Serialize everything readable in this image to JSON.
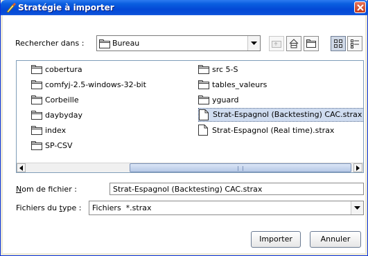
{
  "window": {
    "title": "Stratégie à importer"
  },
  "look_in": {
    "label": "Rechercher dans :",
    "value": "Bureau"
  },
  "toolbar": {
    "up_icon": "up-folder-icon",
    "home_icon": "home-icon",
    "new_folder_icon": "new-folder-icon",
    "list_icon": "list-view-icon",
    "details_icon": "details-view-icon"
  },
  "files": {
    "col1": [
      "cobertura",
      "comfyj-2.5-windows-32-bit",
      "Corbeille",
      "daybyday",
      "index",
      "SP-CSV"
    ],
    "col2": [
      "src 5-S",
      "tables_valeurs",
      "yguard",
      "Strat-Espagnol (Backtesting) CAC.strax",
      "Strat-Espagnol (Real time).strax"
    ],
    "selected": "Strat-Espagnol (Backtesting) CAC.strax"
  },
  "filename": {
    "label_prefix": "N",
    "label_rest": "om de fichier :",
    "value": "Strat-Espagnol (Backtesting) CAC.strax"
  },
  "filetype": {
    "label_prefix": "Fichiers du ",
    "label_u": "t",
    "label_rest": "ype :",
    "value": "Fichiers  *.strax"
  },
  "buttons": {
    "import": "Importer",
    "cancel": "Annuler"
  },
  "colors": {
    "titlebar": "#0449d6",
    "selection": "#cfdcf0"
  }
}
